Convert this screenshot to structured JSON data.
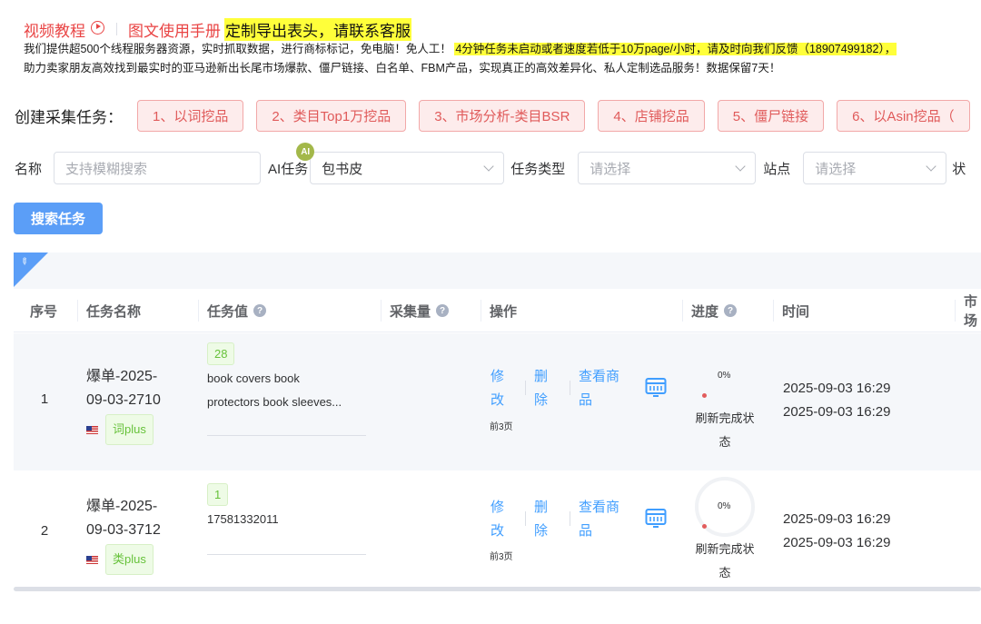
{
  "top_links": {
    "video_tutorial": "视频教程",
    "manual": "图文使用手册",
    "custom_export": "定制导出表头，请联系客服"
  },
  "notice": {
    "line1_plain": "我们提供超500个线程服务器资源，实时抓取数据，进行商标标记，免电脑！免人工！",
    "line1_highlight": "4分钟任务未启动或者速度若低于10万page/小时，请及时向我们反馈（18907499182），",
    "line2": "助力卖家朋友高效找到最实时的亚马逊新出长尾市场爆款、僵尸链接、白名单、FBM产品，实现真正的高效差异化、私人定制选品服务！数据保留7天！"
  },
  "create": {
    "label": "创建采集任务：",
    "chips": [
      "1、以词挖品",
      "2、类目Top1万挖品",
      "3、市场分析-类目BSR",
      "4、店铺挖品",
      "5、僵尸链接",
      "6、以Asin挖品（"
    ]
  },
  "filters": {
    "name_label": "名称",
    "name_placeholder": "支持模糊搜索",
    "ai_label": "AI任务",
    "ai_badge": "AI",
    "ai_value": "包书皮",
    "type_label": "任务类型",
    "type_placeholder": "请选择",
    "site_label": "站点",
    "site_placeholder": "请选择",
    "status_label_partial": "状"
  },
  "search_button": "搜索任务",
  "table": {
    "headers": {
      "index": "序号",
      "task_name": "任务名称",
      "task_value": "任务值",
      "collected": "采集量",
      "actions": "操作",
      "progress": "进度",
      "time": "时间",
      "market_partial": "市场"
    },
    "rows": [
      {
        "index": "1",
        "name_line1": "爆单-2025-",
        "name_line2": "09-03-2710",
        "type_tag": "词plus",
        "count": "28",
        "value_line1": "book covers book",
        "value_line2": "protectors book sleeves...",
        "edit_1": "修",
        "edit_2": "改",
        "delete_1": "删",
        "delete_2": "除",
        "view_1": "查看商",
        "view_2": "品",
        "pages": "前3页",
        "progress_text": "0%",
        "refresh_1": "刷新完成状",
        "refresh_2": "态",
        "time1": "2025-09-03 16:29",
        "time2": "2025-09-03 16:29",
        "progress_value": 0
      },
      {
        "index": "2",
        "name_line1": "爆单-2025-",
        "name_line2": "09-03-3712",
        "type_tag": "类plus",
        "count": "1",
        "value_line1": "17581332011",
        "value_line2": "",
        "edit_1": "修",
        "edit_2": "改",
        "delete_1": "删",
        "delete_2": "除",
        "view_1": "查看商",
        "view_2": "品",
        "pages": "前3页",
        "progress_text": "0%",
        "refresh_1": "刷新完成状",
        "refresh_2": "态",
        "time1": "2025-09-03 16:29",
        "time2": "2025-09-03 16:29",
        "progress_value": 0
      }
    ]
  },
  "colors": {
    "primary": "#409eff",
    "button": "#5b9ef7",
    "chip_bg": "#fdecec",
    "chip_text": "#e05a5a",
    "link_red": "#e94444",
    "highlight": "#ffff3a",
    "tag_green": "#67c23a"
  },
  "icons": [
    "play-circle-icon",
    "pin-icon",
    "question-icon",
    "chevron-down-icon",
    "us-flag-icon",
    "table-view-icon"
  ]
}
